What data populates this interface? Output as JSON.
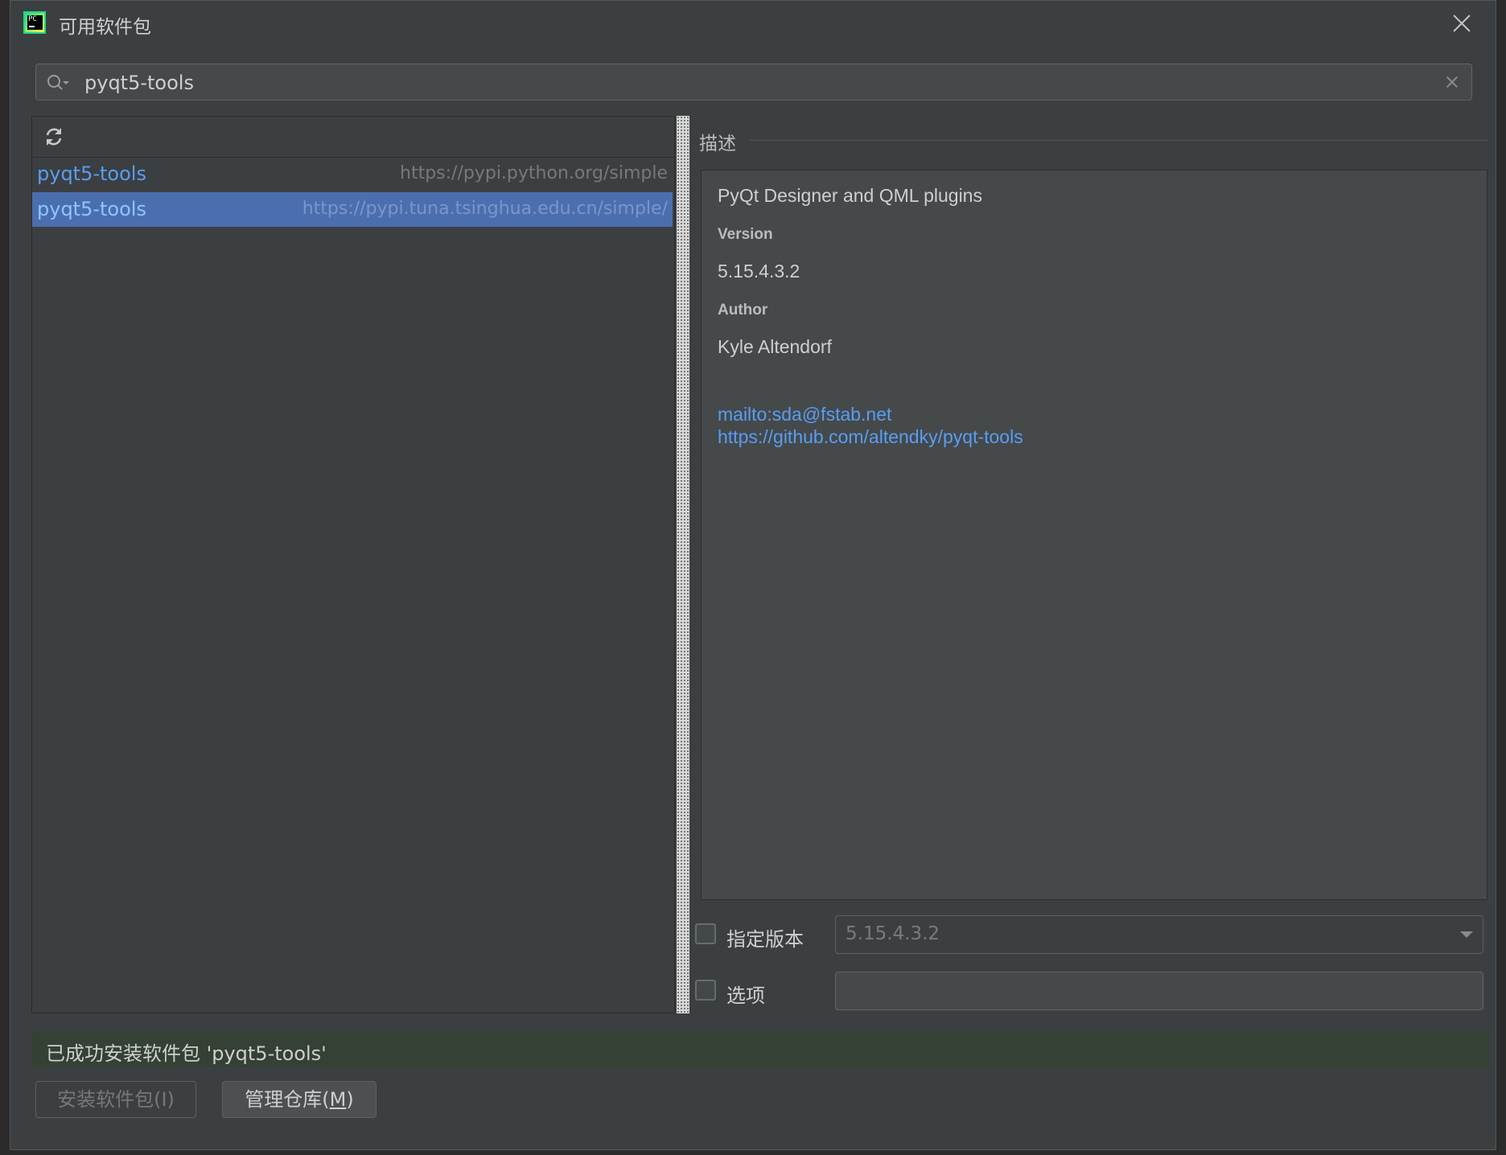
{
  "window": {
    "title": "可用软件包",
    "app_icon_text": "PC"
  },
  "search": {
    "value": "pyqt5-tools",
    "placeholder": ""
  },
  "packages": [
    {
      "name": "pyqt5-tools",
      "repo": "https://pypi.python.org/simple",
      "selected": false
    },
    {
      "name": "pyqt5-tools",
      "repo": "https://pypi.tuna.tsinghua.edu.cn/simple/",
      "selected": true
    }
  ],
  "description": {
    "header": "描述",
    "summary": "PyQt Designer and QML plugins",
    "version_label": "Version",
    "version": "5.15.4.3.2",
    "author_label": "Author",
    "author": "Kyle Altendorf",
    "email_link": "mailto:sda@fstab.net",
    "homepage_link": "https://github.com/altendky/pyqt-tools"
  },
  "options": {
    "specify_version_label": "指定版本",
    "specify_version_checked": false,
    "version_value": "5.15.4.3.2",
    "options_label": "选项",
    "options_checked": false,
    "options_value": ""
  },
  "status": {
    "message": "已成功安装软件包 'pyqt5-tools'"
  },
  "buttons": {
    "install": "安装软件包(I)",
    "manage_prefix": "管理仓库(",
    "manage_key": "M",
    "manage_suffix": ")"
  },
  "colors": {
    "dialog_bg": "#3c3f41",
    "selection": "#4b6eaf",
    "link": "#589df6",
    "status_bg": "#344134"
  }
}
